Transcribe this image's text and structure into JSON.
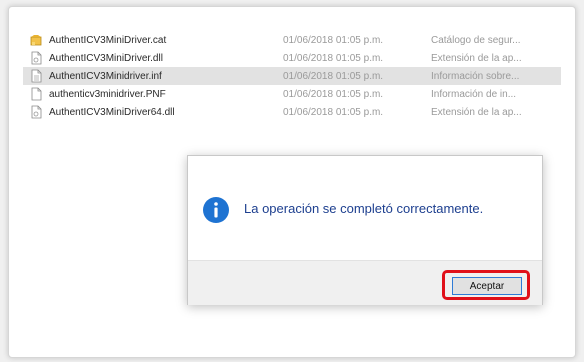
{
  "files": [
    {
      "name": "AuthentICV3MiniDriver.cat",
      "date": "01/06/2018 01:05 p.m.",
      "type": "Catálogo de segur...",
      "icon": "security-catalog-icon",
      "selected": false
    },
    {
      "name": "AuthentICV3MiniDriver.dll",
      "date": "01/06/2018 01:05 p.m.",
      "type": "Extensión de la ap...",
      "icon": "dll-file-icon",
      "selected": false
    },
    {
      "name": "AuthentICV3Minidriver.inf",
      "date": "01/06/2018 01:05 p.m.",
      "type": "Información sobre...",
      "icon": "inf-file-icon",
      "selected": true
    },
    {
      "name": "authenticv3minidriver.PNF",
      "date": "01/06/2018 01:05 p.m.",
      "type": "Información de in...",
      "icon": "pnf-file-icon",
      "selected": false
    },
    {
      "name": "AuthentICV3MiniDriver64.dll",
      "date": "01/06/2018 01:05 p.m.",
      "type": "Extensión de la ap...",
      "icon": "dll-file-icon",
      "selected": false
    }
  ],
  "dialog": {
    "icon": "info-icon",
    "message": "La operación se completó correctamente.",
    "ok_label": "Aceptar"
  },
  "colors": {
    "message_text": "#1d3f8f",
    "info_icon": "#1e73d2",
    "highlight": "#e0101a",
    "selected_row": "#e2e2e2"
  }
}
